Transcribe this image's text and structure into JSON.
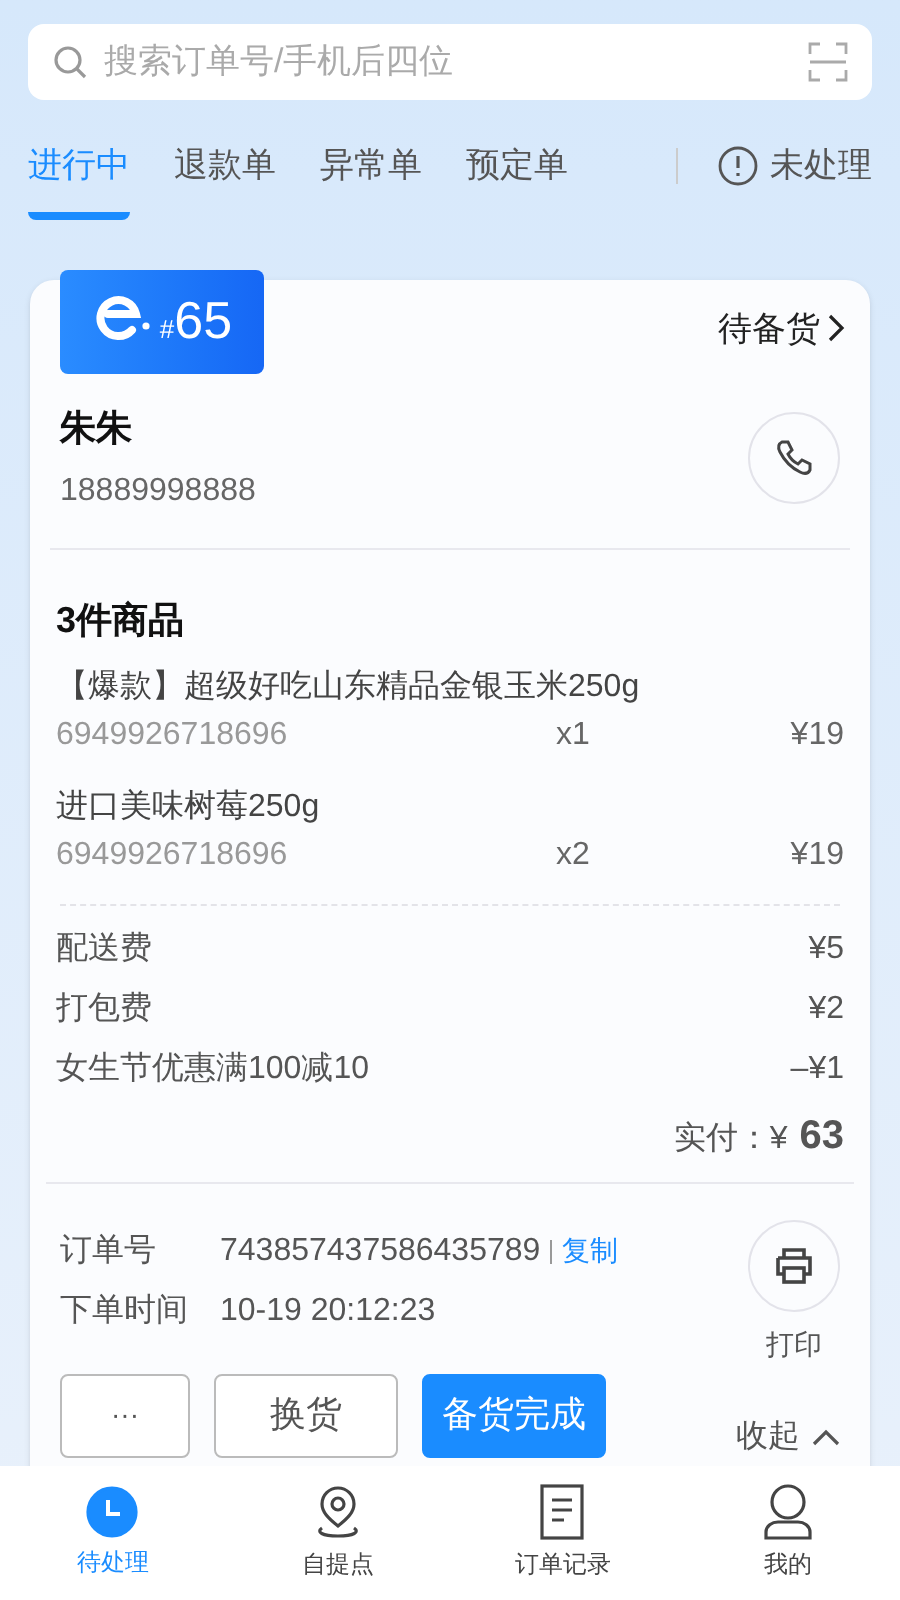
{
  "search": {
    "placeholder": "搜索订单号/手机后四位"
  },
  "tabs": [
    {
      "label": "进行中",
      "selected": true
    },
    {
      "label": "退款单",
      "selected": false
    },
    {
      "label": "异常单",
      "selected": false
    },
    {
      "label": "预定单",
      "selected": false
    }
  ],
  "unprocessed": {
    "label": "未处理"
  },
  "order": {
    "badge_prefix": "#",
    "badge_number": "65",
    "status": "待备货",
    "customer_name": "朱朱",
    "phone": "18889998888",
    "items_title": "3件商品",
    "items": [
      {
        "name": "【爆款】超级好吃山东精品金银玉米250g",
        "code": "6949926718696",
        "qty": "x1",
        "price": "¥19"
      },
      {
        "name": "进口美味树莓250g",
        "code": "6949926718696",
        "qty": "x2",
        "price": "¥19"
      }
    ],
    "fees": [
      {
        "label": "配送费",
        "amount": "¥5"
      },
      {
        "label": "打包费",
        "amount": "¥2"
      },
      {
        "label": "女生节优惠满100减10",
        "amount": "–¥1"
      }
    ],
    "total_label": "实付：¥",
    "total": "63",
    "info": [
      {
        "label": "订单号",
        "value": "743857437586435789",
        "copy": "复制"
      },
      {
        "label": "下单时间",
        "value": "10-19 20:12:23"
      }
    ],
    "print": "打印",
    "actions": [
      {
        "label": "···",
        "kind": "more"
      },
      {
        "label": "换货",
        "kind": "outline"
      },
      {
        "label": "备货完成",
        "kind": "primary"
      }
    ],
    "collapse": "收起"
  },
  "bottom_nav": [
    {
      "label": "待处理",
      "selected": true,
      "kind": "clock"
    },
    {
      "label": "自提点",
      "selected": false,
      "kind": "pin"
    },
    {
      "label": "订单记录",
      "selected": false,
      "kind": "doc"
    },
    {
      "label": "我的",
      "selected": false,
      "kind": "user"
    }
  ]
}
